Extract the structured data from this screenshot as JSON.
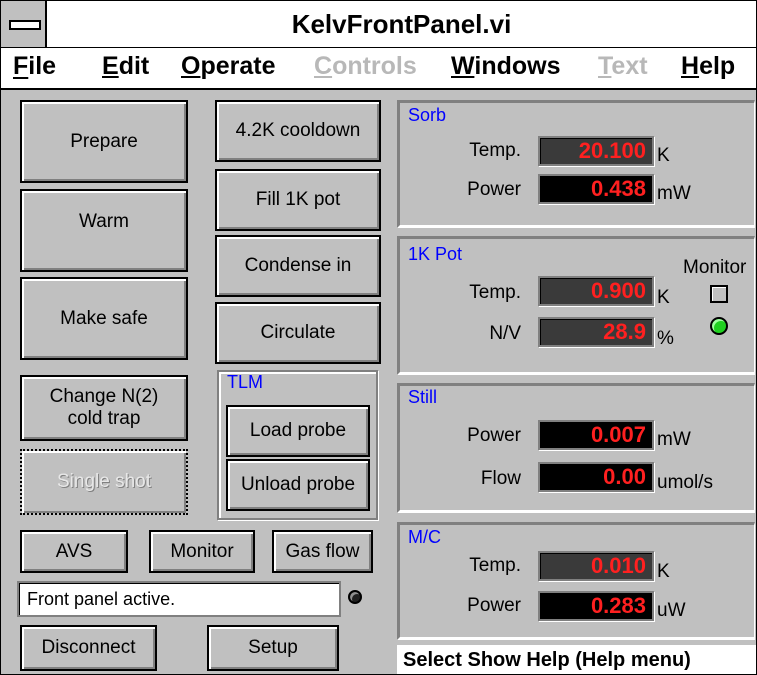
{
  "window": {
    "title": "KelvFrontPanel.vi"
  },
  "menubar": {
    "items": [
      {
        "label": "File",
        "disabled": false
      },
      {
        "label": "Edit",
        "disabled": false
      },
      {
        "label": "Operate",
        "disabled": false
      },
      {
        "label": "Controls",
        "disabled": true
      },
      {
        "label": "Windows",
        "disabled": false
      },
      {
        "label": "Text",
        "disabled": true
      },
      {
        "label": "Help",
        "disabled": false
      }
    ]
  },
  "buttons": {
    "prepare": "Prepare",
    "warm": "Warm",
    "make_safe": "Make safe",
    "change_n2_line1": "Change N(2)",
    "change_n2_line2": "cold trap",
    "single_shot": "Single shot",
    "cooldown": "4.2K cooldown",
    "fill_1k_pot": "Fill 1K pot",
    "condense_in": "Condense in",
    "circulate": "Circulate",
    "load_probe": "Load probe",
    "unload_probe": "Unload probe",
    "avs": "AVS",
    "monitor": "Monitor",
    "gas_flow": "Gas flow",
    "disconnect": "Disconnect",
    "setup": "Setup"
  },
  "tlm": {
    "label": "TLM"
  },
  "status": {
    "text": "Front panel active."
  },
  "sorb": {
    "label": "Sorb",
    "temp_label": "Temp.",
    "temp_value": "20.100",
    "temp_unit": "K",
    "power_label": "Power",
    "power_value": "0.438",
    "power_unit": "mW"
  },
  "pot": {
    "label": "1K Pot",
    "temp_label": "Temp.",
    "temp_value": "0.900",
    "temp_unit": "K",
    "nv_label": "N/V",
    "nv_value": "28.9",
    "nv_unit": "%",
    "monitor_label": "Monitor"
  },
  "still": {
    "label": "Still",
    "power_label": "Power",
    "power_value": "0.007",
    "power_unit": "mW",
    "flow_label": "Flow",
    "flow_value": "0.00",
    "flow_unit": "umol/s"
  },
  "mc": {
    "label": "M/C",
    "temp_label": "Temp.",
    "temp_value": "0.010",
    "temp_unit": "K",
    "power_label": "Power",
    "power_value": "0.283",
    "power_unit": "uW"
  },
  "helpbar": {
    "text": "Select Show Help (Help menu)"
  },
  "colors": {
    "display_text": "#ff2020",
    "panel_label": "#0000ff",
    "led_on": "#20d020"
  }
}
